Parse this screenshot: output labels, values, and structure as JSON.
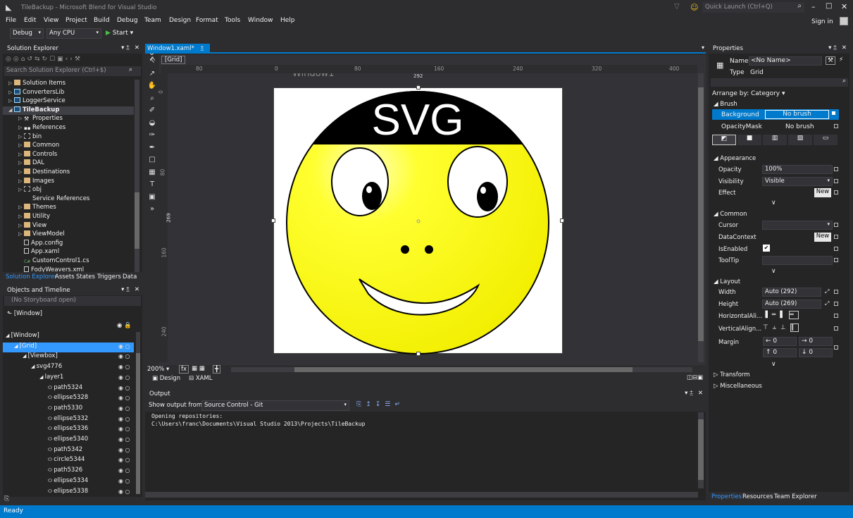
{
  "title": "TileBackup - Microsoft Blend for Visual Studio",
  "quick_launch": "Quick Launch (Ctrl+Q)",
  "sign_in": "Sign in",
  "menu": [
    "File",
    "Edit",
    "View",
    "Project",
    "Build",
    "Debug",
    "Team",
    "Design",
    "Format",
    "Tools",
    "Window",
    "Help"
  ],
  "toolbar": {
    "config": "Debug",
    "platform": "Any CPU",
    "start": "Start"
  },
  "solution_explorer": {
    "title": "Solution Explorer",
    "search_placeholder": "Search Solution Explorer (Ctrl+$)",
    "items": [
      {
        "label": "Solution Items",
        "indent": 0,
        "kind": "folder"
      },
      {
        "label": "ConvertersLib",
        "indent": 0,
        "kind": "proj"
      },
      {
        "label": "LoggerService",
        "indent": 0,
        "kind": "proj"
      },
      {
        "label": "TileBackup",
        "indent": 0,
        "kind": "proj",
        "selected": true,
        "bold": true
      },
      {
        "label": "Properties",
        "indent": 1,
        "kind": "wrench"
      },
      {
        "label": "References",
        "indent": 1,
        "kind": "ref"
      },
      {
        "label": "bin",
        "indent": 1,
        "kind": "hfolder"
      },
      {
        "label": "Common",
        "indent": 1,
        "kind": "folder"
      },
      {
        "label": "Controls",
        "indent": 1,
        "kind": "folder"
      },
      {
        "label": "DAL",
        "indent": 1,
        "kind": "folder"
      },
      {
        "label": "Destinations",
        "indent": 1,
        "kind": "folder"
      },
      {
        "label": "Images",
        "indent": 1,
        "kind": "folder"
      },
      {
        "label": "obj",
        "indent": 1,
        "kind": "hfolder"
      },
      {
        "label": "Service References",
        "indent": 1,
        "kind": "none"
      },
      {
        "label": "Themes",
        "indent": 1,
        "kind": "folder"
      },
      {
        "label": "Utility",
        "indent": 1,
        "kind": "folder"
      },
      {
        "label": "View",
        "indent": 1,
        "kind": "folder"
      },
      {
        "label": "ViewModel",
        "indent": 1,
        "kind": "folder"
      },
      {
        "label": "App.config",
        "indent": 1,
        "kind": "file"
      },
      {
        "label": "App.xaml",
        "indent": 1,
        "kind": "file"
      },
      {
        "label": "CustomControl1.cs",
        "indent": 1,
        "kind": "cs"
      },
      {
        "label": "FodyWeavers.xml",
        "indent": 1,
        "kind": "file"
      }
    ],
    "tabs": [
      "Solution Explorer",
      "Assets",
      "States",
      "Triggers",
      "Data"
    ]
  },
  "objects_timeline": {
    "title": "Objects and Timeline",
    "storyboard": "(No Storyboard open)",
    "window_root": "[Window]",
    "tree": [
      {
        "label": "[Window]",
        "indent": 0,
        "selected": false
      },
      {
        "label": "[Grid]",
        "indent": 1,
        "selected": true
      },
      {
        "label": "[Viewbox]",
        "indent": 2,
        "selected": false
      },
      {
        "label": "svg4776",
        "indent": 3,
        "selected": false
      },
      {
        "label": "layer1",
        "indent": 4,
        "selected": false
      },
      {
        "label": "path5324",
        "indent": 5,
        "selected": false
      },
      {
        "label": "ellipse5328",
        "indent": 5,
        "selected": false
      },
      {
        "label": "path5330",
        "indent": 5,
        "selected": false
      },
      {
        "label": "ellipse5332",
        "indent": 5,
        "selected": false
      },
      {
        "label": "ellipse5336",
        "indent": 5,
        "selected": false
      },
      {
        "label": "ellipse5340",
        "indent": 5,
        "selected": false
      },
      {
        "label": "path5342",
        "indent": 5,
        "selected": false
      },
      {
        "label": "circle5344",
        "indent": 5,
        "selected": false
      },
      {
        "label": "path5326",
        "indent": 5,
        "selected": false
      },
      {
        "label": "ellipse5334",
        "indent": 5,
        "selected": false
      },
      {
        "label": "ellipse5338",
        "indent": 5,
        "selected": false
      }
    ]
  },
  "designer": {
    "tab": "Window1.xaml*",
    "breadcrumb": "[Grid]",
    "window_title": "Window1",
    "svg_text": "SVG",
    "ruler_top": [
      "80",
      "0",
      "80",
      "160",
      "240",
      "320",
      "400"
    ],
    "ruler_left": [
      "0",
      "80",
      "160",
      "240"
    ],
    "dim_width": "292",
    "dim_height": "269",
    "zoom": "200%",
    "view_tabs": [
      "Design",
      "XAML"
    ]
  },
  "output": {
    "title": "Output",
    "show_from_label": "Show output from:",
    "source": "Source Control - Git",
    "lines": [
      "Opening repositories:",
      "C:\\Users\\franc\\Documents\\Visual Studio 2013\\Projects\\TileBackup"
    ]
  },
  "properties": {
    "title": "Properties",
    "name_label": "Name",
    "name_value": "<No Name>",
    "type_label": "Type",
    "type_value": "Grid",
    "arrange": "Arrange by: Category",
    "brush_section": "Brush",
    "background": "Background",
    "background_val": "No brush",
    "opacitymask": "OpacityMask",
    "opacitymask_val": "No brush",
    "appearance": "Appearance",
    "opacity": "Opacity",
    "opacity_val": "100%",
    "visibility": "Visibility",
    "visibility_val": "Visible",
    "effect": "Effect",
    "new": "New",
    "common": "Common",
    "cursor": "Cursor",
    "datacontext": "DataContext",
    "isenabled": "IsEnabled",
    "tooltip": "ToolTip",
    "layout": "Layout",
    "width": "Width",
    "width_val": "Auto (292)",
    "height": "Height",
    "height_val": "Auto (269)",
    "halign": "HorizontalAli...",
    "valign": "VerticalAlign...",
    "margin": "Margin",
    "margin_vals": [
      "0",
      "0",
      "0",
      "0"
    ],
    "transform": "Transform",
    "misc": "Miscellaneous",
    "bottom_tabs": [
      "Properties",
      "Resources",
      "Team Explorer"
    ]
  },
  "status": "Ready"
}
